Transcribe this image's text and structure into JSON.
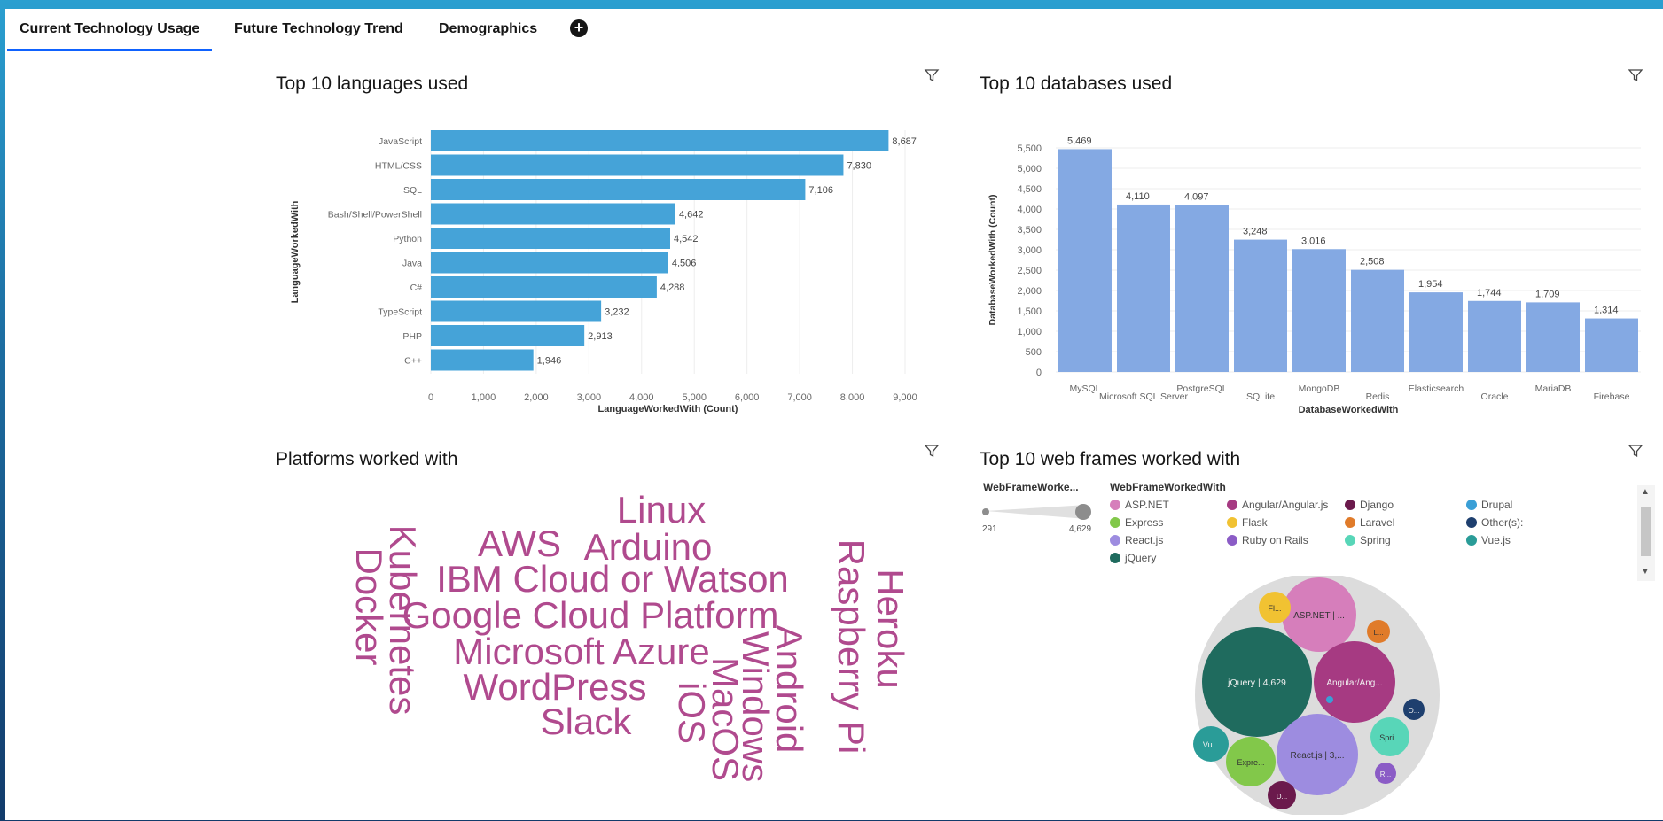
{
  "tabs": [
    {
      "label": "Current Technology Usage",
      "active": true
    },
    {
      "label": "Future Technology Trend",
      "active": false
    },
    {
      "label": "Demographics",
      "active": false
    }
  ],
  "add_tab_label": "+",
  "panels": {
    "languages": {
      "title": "Top 10 languages used"
    },
    "databases": {
      "title": "Top 10 databases used"
    },
    "platforms": {
      "title": "Platforms worked with"
    },
    "webframes": {
      "title": "Top 10 web frames worked with"
    }
  },
  "icons": {
    "filter": "filter-icon",
    "add_tab": "plus-circle-icon"
  },
  "colors": {
    "bar_languages": "#45a3d8",
    "bar_databases": "#84a9e3",
    "wordcloud": "#b04a8e",
    "tab_active": "#0f62fe"
  },
  "chart_data": [
    {
      "type": "bar",
      "orientation": "horizontal",
      "title": "Top 10 languages used",
      "xlabel": "LanguageWorkedWith (Count)",
      "ylabel": "LanguageWorkedWith",
      "xlim": [
        0,
        9000
      ],
      "xticks": [
        "0",
        "1,000",
        "2,000",
        "3,000",
        "4,000",
        "5,000",
        "6,000",
        "7,000",
        "8,000",
        "9,000"
      ],
      "categories": [
        "JavaScript",
        "HTML/CSS",
        "SQL",
        "Bash/Shell/PowerShell",
        "Python",
        "Java",
        "C#",
        "TypeScript",
        "PHP",
        "C++"
      ],
      "values": [
        8687,
        7830,
        7106,
        4642,
        4542,
        4506,
        4288,
        3232,
        2913,
        1946
      ],
      "value_labels": [
        "8,687",
        "7,830",
        "7,106",
        "4,642",
        "4,542",
        "4,506",
        "4,288",
        "3,232",
        "2,913",
        "1,946"
      ],
      "grid": true
    },
    {
      "type": "bar",
      "orientation": "vertical",
      "title": "Top 10 databases used",
      "xlabel": "DatabaseWorkedWith",
      "ylabel": "DatabaseWorkedWith (Count)",
      "ylim": [
        0,
        5500
      ],
      "yticks": [
        "0",
        "500",
        "1,000",
        "1,500",
        "2,000",
        "2,500",
        "3,000",
        "3,500",
        "4,000",
        "4,500",
        "5,000",
        "5,500"
      ],
      "categories": [
        "MySQL",
        "Microsoft SQL Server",
        "PostgreSQL",
        "SQLite",
        "MongoDB",
        "Redis",
        "Elasticsearch",
        "Oracle",
        "MariaDB",
        "Firebase"
      ],
      "values": [
        5469,
        4110,
        4097,
        3248,
        3016,
        2508,
        1954,
        1744,
        1709,
        1314
      ],
      "value_labels": [
        "5,469",
        "4,110",
        "4,097",
        "3,248",
        "3,016",
        "2,508",
        "1,954",
        "1,744",
        "1,709",
        "1,314"
      ],
      "grid": true
    },
    {
      "type": "wordcloud",
      "title": "Platforms worked with",
      "words": [
        "Linux",
        "AWS",
        "Arduino",
        "IBM Cloud or Watson",
        "Google Cloud Platform",
        "Microsoft Azure",
        "WordPress",
        "Slack",
        "Kubernetes",
        "Docker",
        "Raspberry Pi",
        "Heroku",
        "Android",
        "Windows",
        "MacOS",
        "iOS"
      ]
    },
    {
      "type": "bubble",
      "title": "Top 10 web frames worked with",
      "size_legend_title": "WebFrameWorke...",
      "size_range_labels": [
        "291",
        "4,629"
      ],
      "size_range": [
        291,
        4629
      ],
      "color_legend_title": "WebFrameWorkedWith",
      "legend": [
        {
          "name": "ASP.NET",
          "color": "#d67ebb"
        },
        {
          "name": "Angular/Angular.js",
          "color": "#a63a82"
        },
        {
          "name": "Django",
          "color": "#6b1a4c"
        },
        {
          "name": "Drupal",
          "color": "#3a9fd6"
        },
        {
          "name": "Express",
          "color": "#82c84a"
        },
        {
          "name": "Flask",
          "color": "#f1c232"
        },
        {
          "name": "Laravel",
          "color": "#e07b2a"
        },
        {
          "name": "Other(s):",
          "color": "#1e3f6e"
        },
        {
          "name": "React.js",
          "color": "#9d8ce0"
        },
        {
          "name": "Ruby on Rails",
          "color": "#8b5cc6"
        },
        {
          "name": "Spring",
          "color": "#58d6b8"
        },
        {
          "name": "Vue.js",
          "color": "#2a9c98"
        },
        {
          "name": "jQuery",
          "color": "#1f6b5e"
        }
      ],
      "bubble_labels": [
        {
          "name": "jQuery",
          "label": "jQuery | 4,629"
        },
        {
          "name": "ASP.NET",
          "label": "ASP.NET | ..."
        },
        {
          "name": "Angular/Angular.js",
          "label": "Angular/Ang..."
        },
        {
          "name": "React.js",
          "label": "React.js | 3,..."
        },
        {
          "name": "Express",
          "label": "Expre..."
        },
        {
          "name": "Vue.js",
          "label": "Vu..."
        },
        {
          "name": "Spring",
          "label": "Spri..."
        },
        {
          "name": "Flask",
          "label": "Fl..."
        },
        {
          "name": "Laravel",
          "label": "L..."
        },
        {
          "name": "Other(s):",
          "label": "O..."
        },
        {
          "name": "Ruby on Rails",
          "label": "R..."
        },
        {
          "name": "Django",
          "label": "D..."
        },
        {
          "name": "Drupal",
          "label": ""
        }
      ]
    }
  ]
}
